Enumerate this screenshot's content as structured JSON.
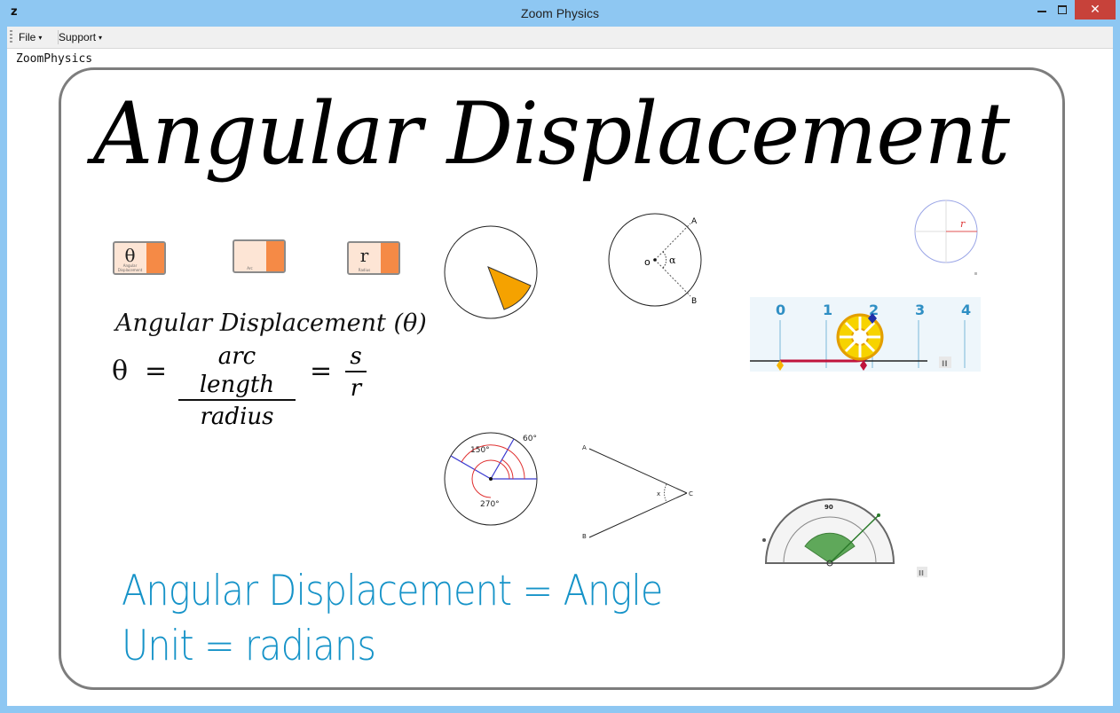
{
  "window": {
    "title": "Zoom Physics",
    "icon_letter": "z",
    "close_glyph": "✕"
  },
  "menu": {
    "file_label": "File",
    "support_label": "Support",
    "dropdown_arrow": "▾"
  },
  "app": {
    "text_label": "ZoomPhysics"
  },
  "slide": {
    "title": "Angular Displacement",
    "tiles": [
      {
        "symbol": "θ",
        "caption": "Angular Displacement"
      },
      {
        "symbol": "",
        "caption": "Arc"
      },
      {
        "symbol": "r",
        "caption": "Radius"
      }
    ],
    "formula": {
      "title": "Angular Displacement (θ)",
      "theta": "θ",
      "equals": "=",
      "numerator1": "arc length",
      "denominator1": "radius",
      "numerator2": "s",
      "denominator2": "r"
    },
    "diagrams": {
      "circle_point_a": "A",
      "circle_point_b": "B",
      "circle_center": "o",
      "circle_angle": "α",
      "radius_label": "r",
      "ruler_ticks": [
        "0",
        "1",
        "2",
        "3",
        "4"
      ],
      "angle_150": "150°",
      "angle_60": "60°",
      "angle_270": "270°",
      "v_point_a": "A",
      "v_point_b": "B",
      "v_point_c": "C",
      "v_angle": "x",
      "protractor_top": "90",
      "pause_glyph": "II"
    },
    "handwriting": {
      "line1": "Angular Displacement = Angle",
      "line2": "Unit = radians"
    }
  },
  "colors": {
    "sector_fill": "#f5a200",
    "handwriting": "#1693c8",
    "tile_accent": "#f58a46",
    "titlebar": "#8ec7f2",
    "close_button": "#c7423a"
  }
}
